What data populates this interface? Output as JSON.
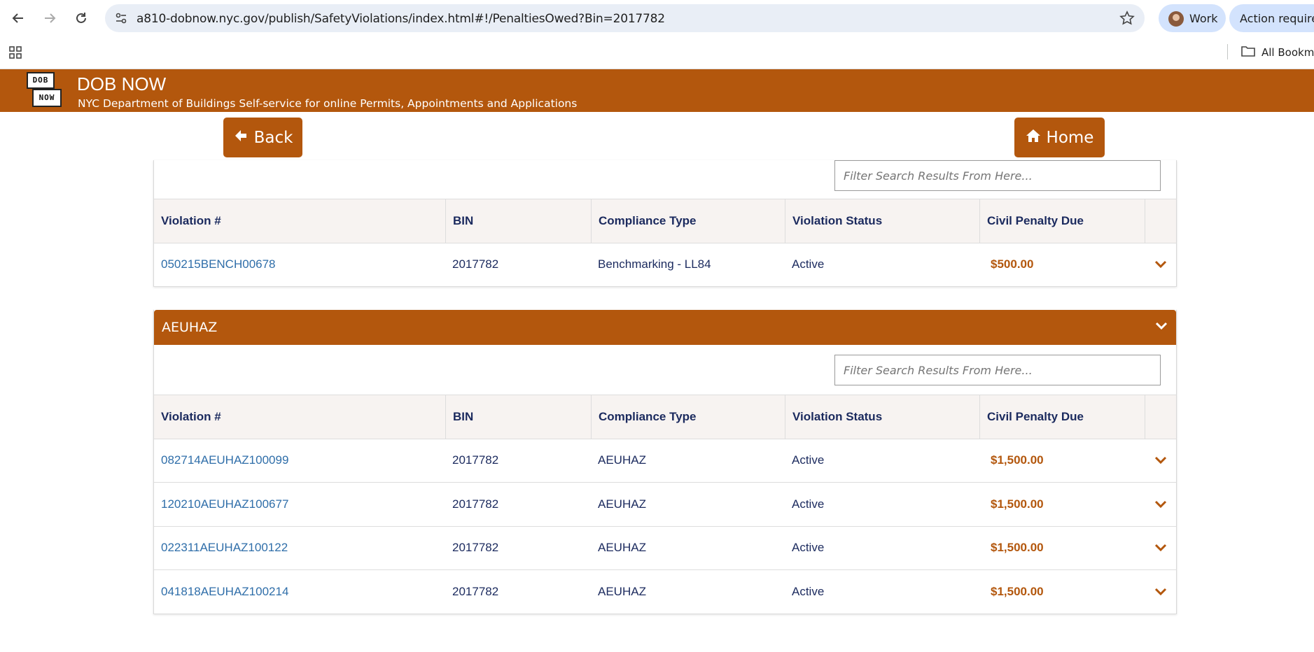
{
  "browser": {
    "url": "a810-dobnow.nyc.gov/publish/SafetyViolations/index.html#!/PenaltiesOwed?Bin=2017782",
    "profile_label": "Work",
    "action_label": "Action required",
    "bookmarks_label": "All Bookma"
  },
  "app": {
    "logo_top": "DOB",
    "logo_bottom": "NOW",
    "title": "DOB NOW",
    "subtitle": "NYC Department of Buildings Self-service for online Permits, Appointments and Applications"
  },
  "nav": {
    "back_label": "Back",
    "home_label": "Home"
  },
  "colors": {
    "brand": "#b3570d",
    "header_text": "#1b2a5e",
    "link": "#2f6ea9"
  },
  "columns": [
    "Violation #",
    "BIN",
    "Compliance Type",
    "Violation Status",
    "Civil Penalty Due"
  ],
  "panels": [
    {
      "title": "",
      "filter_placeholder": "Filter Search Results From Here...",
      "rows": [
        {
          "violation": "050215BENCH00678",
          "bin": "2017782",
          "type": "Benchmarking - LL84",
          "status": "Active",
          "penalty": "$500.00"
        }
      ]
    },
    {
      "title": "AEUHAZ",
      "filter_placeholder": "Filter Search Results From Here...",
      "rows": [
        {
          "violation": "082714AEUHAZ100099",
          "bin": "2017782",
          "type": "AEUHAZ",
          "status": "Active",
          "penalty": "$1,500.00"
        },
        {
          "violation": "120210AEUHAZ100677",
          "bin": "2017782",
          "type": "AEUHAZ",
          "status": "Active",
          "penalty": "$1,500.00"
        },
        {
          "violation": "022311AEUHAZ100122",
          "bin": "2017782",
          "type": "AEUHAZ",
          "status": "Active",
          "penalty": "$1,500.00"
        },
        {
          "violation": "041818AEUHAZ100214",
          "bin": "2017782",
          "type": "AEUHAZ",
          "status": "Active",
          "penalty": "$1,500.00"
        }
      ]
    }
  ]
}
